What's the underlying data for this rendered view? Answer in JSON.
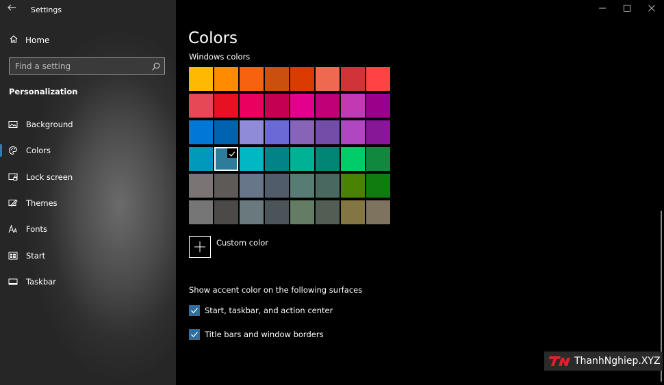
{
  "window": {
    "title": "Settings",
    "back_icon": "back-arrow-icon",
    "controls": [
      "minimize-icon",
      "maximize-icon",
      "close-icon"
    ]
  },
  "sidebar": {
    "home_label": "Home",
    "search": {
      "placeholder": "Find a setting",
      "value": ""
    },
    "section_title": "Personalization",
    "items": [
      {
        "label": "Background",
        "icon": "image-icon",
        "active": false
      },
      {
        "label": "Colors",
        "icon": "palette-icon",
        "active": true
      },
      {
        "label": "Lock screen",
        "icon": "lock-screen-icon",
        "active": false
      },
      {
        "label": "Themes",
        "icon": "themes-icon",
        "active": false
      },
      {
        "label": "Fonts",
        "icon": "fonts-icon",
        "active": false
      },
      {
        "label": "Start",
        "icon": "start-icon",
        "active": false
      },
      {
        "label": "Taskbar",
        "icon": "taskbar-icon",
        "active": false
      }
    ]
  },
  "main": {
    "title": "Colors",
    "windows_colors_label": "Windows colors",
    "selected_index": 25,
    "swatches": [
      "#FFB900",
      "#FF8C00",
      "#F7630C",
      "#CA5010",
      "#DA3B01",
      "#EF6950",
      "#D13438",
      "#FF4343",
      "#E74856",
      "#E81123",
      "#EA005E",
      "#C30052",
      "#E3008C",
      "#BF0077",
      "#C239B3",
      "#9A0089",
      "#0078D7",
      "#0063B1",
      "#8E8CD8",
      "#6B69D6",
      "#8764B8",
      "#744DA9",
      "#B146C2",
      "#881798",
      "#0099BC",
      "#2D7D9A",
      "#00B7C3",
      "#038387",
      "#00B294",
      "#018574",
      "#00CC6A",
      "#10893E",
      "#7A7574",
      "#5D5A58",
      "#68768A",
      "#515C6B",
      "#567C73",
      "#486860",
      "#498205",
      "#107C10",
      "#767676",
      "#4C4A48",
      "#69797E",
      "#4A5459",
      "#647C64",
      "#525E54",
      "#847545",
      "#7E735F"
    ],
    "custom_color_label": "Custom color",
    "surfaces_label": "Show accent color on the following surfaces",
    "checkboxes": [
      {
        "label": "Start, taskbar, and action center",
        "checked": true
      },
      {
        "label": "Title bars and window borders",
        "checked": true
      }
    ],
    "accent": "#2F6E9E"
  },
  "watermark": {
    "text": "ThanhNghiep.XYZ"
  }
}
